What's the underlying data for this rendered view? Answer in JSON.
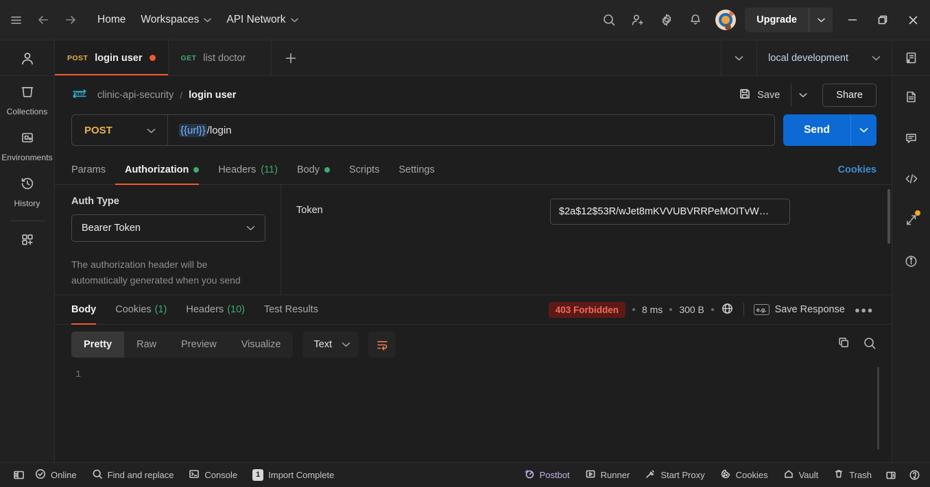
{
  "header": {
    "menu_icon": "hamburger-icon",
    "back_icon": "back-arrow-icon",
    "forward_icon": "forward-arrow-icon",
    "home_label": "Home",
    "workspaces_label": "Workspaces",
    "api_network_label": "API Network",
    "search_icon": "search-icon",
    "invite_icon": "invite-user-icon",
    "settings_icon": "gear-icon",
    "notifications_icon": "bell-icon",
    "avatar": "avatar",
    "upgrade_label": "Upgrade",
    "minimize_icon": "minimize-icon",
    "maximize_icon": "maximize-icon",
    "close_icon": "close-icon"
  },
  "sidebar": {
    "profile_icon": "user-icon",
    "items": [
      {
        "label": "Collections",
        "icon": "collections-icon"
      },
      {
        "label": "Environments",
        "icon": "environments-icon"
      },
      {
        "label": "History",
        "icon": "history-icon"
      }
    ],
    "add_label": "",
    "add_icon": "new-module-icon"
  },
  "right_rail": {
    "items": [
      {
        "icon": "environment-quick-look-icon"
      },
      {
        "icon": "documentation-icon"
      },
      {
        "icon": "comments-icon"
      },
      {
        "icon": "code-snippet-icon"
      },
      {
        "icon": "fork-changes-icon",
        "badge": true
      },
      {
        "icon": "info-icon"
      }
    ]
  },
  "tabs": {
    "items": [
      {
        "method": "POST",
        "name": "login user",
        "active": true,
        "unsaved": true
      },
      {
        "method": "GET",
        "name": "list doctor",
        "active": false,
        "unsaved": false
      }
    ],
    "add_icon": "new-tab-icon",
    "overflow_icon": "chevron-down-icon",
    "environment": "local development",
    "env_quick_look_icon": "environment-quick-look-icon"
  },
  "request": {
    "breadcrumb": {
      "protocol_badge": "HTTP",
      "collection": "clinic-api-security",
      "separator": "/",
      "name": "login user"
    },
    "save_label": "Save",
    "save_icon": "save-icon",
    "share_label": "Share",
    "method": "POST",
    "url_variable": "{{url}}",
    "url_path": "/login",
    "send_label": "Send",
    "tabs": [
      {
        "label": "Params",
        "active": false
      },
      {
        "label": "Authorization",
        "active": true,
        "dot": true
      },
      {
        "label": "Headers",
        "count": "(11)",
        "active": false
      },
      {
        "label": "Body",
        "active": false,
        "dot": true
      },
      {
        "label": "Scripts",
        "active": false
      },
      {
        "label": "Settings",
        "active": false
      }
    ],
    "cookies_link": "Cookies",
    "auth": {
      "type_label": "Auth Type",
      "type_value": "Bearer Token",
      "description": "The authorization header will be automatically generated when you send",
      "token_label": "Token",
      "token_value": "$2a$12$53R/wJet8mKVVUBVRRPeMOITvW…"
    }
  },
  "response": {
    "tabs": [
      {
        "label": "Body",
        "active": true
      },
      {
        "label": "Cookies",
        "count": "(1)",
        "active": false
      },
      {
        "label": "Headers",
        "count": "(10)",
        "active": false
      },
      {
        "label": "Test Results",
        "active": false
      }
    ],
    "status": "403 Forbidden",
    "time": "8 ms",
    "size": "300 B",
    "globe_icon": "globe-icon",
    "example_badge": "e.g.",
    "save_response_label": "Save Response",
    "more_icon": "more-options-icon",
    "view_modes": [
      {
        "label": "Pretty",
        "active": true
      },
      {
        "label": "Raw",
        "active": false
      },
      {
        "label": "Preview",
        "active": false
      },
      {
        "label": "Visualize",
        "active": false
      }
    ],
    "format": "Text",
    "wrap_icon": "wrap-lines-icon",
    "copy_icon": "copy-icon",
    "search_icon": "search-icon",
    "body_line_number": "1",
    "body_text": ""
  },
  "statusbar": {
    "sidebar_toggle_icon": "toggle-sidebar-icon",
    "left_items": [
      {
        "label": "Online",
        "icon": "online-check-icon"
      },
      {
        "label": "Find and replace",
        "icon": "search-icon"
      },
      {
        "label": "Console",
        "icon": "console-icon"
      },
      {
        "label": "Import Complete",
        "icon": "",
        "badge": "1"
      }
    ],
    "right_items": [
      {
        "label": "Postbot",
        "icon": "postbot-icon"
      },
      {
        "label": "Runner",
        "icon": "runner-icon"
      },
      {
        "label": "Start Proxy",
        "icon": "proxy-icon"
      },
      {
        "label": "Cookies",
        "icon": "cookies-icon"
      },
      {
        "label": "Vault",
        "icon": "vault-icon"
      },
      {
        "label": "Trash",
        "icon": "trash-icon"
      },
      {
        "label": "",
        "icon": "layout-icon"
      },
      {
        "label": "",
        "icon": "help-icon"
      }
    ]
  },
  "colors": {
    "accent_orange": "#f15a32",
    "send_blue": "#0d6ad4",
    "method_post": "#e8b04b",
    "method_get": "#3dab6e",
    "status_error_text": "#f06a5c",
    "status_error_bg": "#5c1a16",
    "link_blue": "#3e8ed0"
  }
}
